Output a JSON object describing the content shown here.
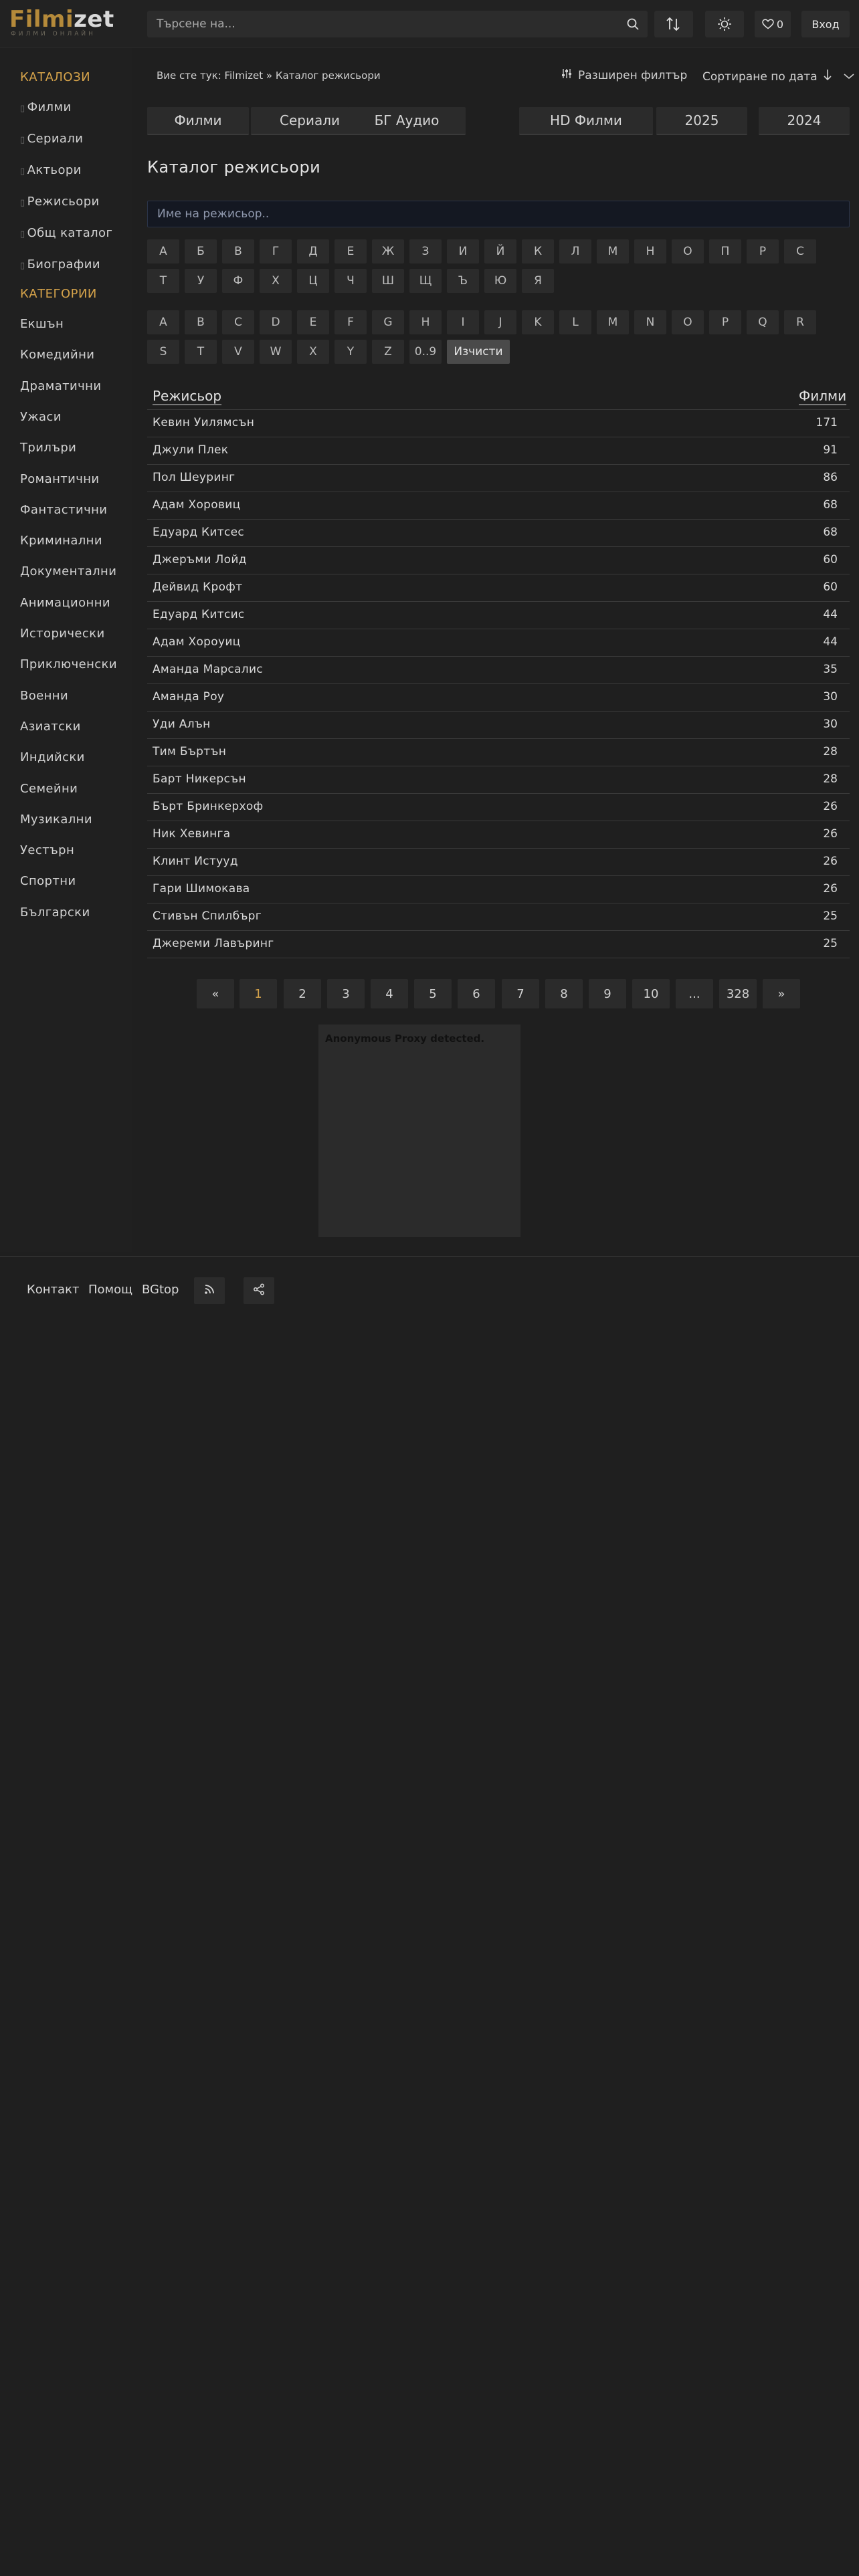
{
  "header": {
    "logo_part1": "Filmi",
    "logo_part2": "zet",
    "logo_tagline": "ФИЛМИ ОНЛАЙН",
    "search_placeholder": "Търсене на...",
    "favorites_count": "0",
    "login_label": "Вход"
  },
  "sidebar": {
    "catalogs_heading": "КАТАЛОЗИ",
    "catalogs": [
      "Филми",
      "Сериали",
      "Актьори",
      "Режисьори",
      "Общ каталог",
      "Биографии"
    ],
    "categories_heading": "КАТЕГОРИИ",
    "categories": [
      "Екшън",
      "Комедийни",
      "Драматични",
      "Ужаси",
      "Трилъри",
      "Романтични",
      "Фантастични",
      "Криминални",
      "Документални",
      "Анимационни",
      "Исторически",
      "Приключенски",
      "Военни",
      "Азиатски",
      "Индийски",
      "Семейни",
      "Музикални",
      "Уестърн",
      "Спортни",
      "Български"
    ]
  },
  "breadcrumb": "Вие сте тук: Filmizet » Каталог режисьори",
  "advanced_filter_label": "Разширен  филтър",
  "sort_label": "Сортиране по дата",
  "tabs": [
    "Филми",
    "Сериали",
    "БГ Аудио",
    "HD Филми",
    "2025",
    "2024"
  ],
  "page_title": "Каталог режисьори",
  "name_placeholder": "Име на режисьор..",
  "cyrillic_letters": [
    "А",
    "Б",
    "В",
    "Г",
    "Д",
    "Е",
    "Ж",
    "З",
    "И",
    "Й",
    "К",
    "Л",
    "М",
    "Н",
    "О",
    "П",
    "Р",
    "С",
    "Т",
    "У",
    "Ф",
    "Х",
    "Ц",
    "Ч",
    "Ш",
    "Щ",
    "Ъ",
    "Ю",
    "Я"
  ],
  "latin_letters": [
    "A",
    "B",
    "C",
    "D",
    "E",
    "F",
    "G",
    "H",
    "I",
    "J",
    "K",
    "L",
    "M",
    "N",
    "O",
    "P",
    "Q",
    "R",
    "S",
    "T",
    "V",
    "W",
    "X",
    "Y",
    "Z",
    "0..9"
  ],
  "clear_label": "Изчисти",
  "table": {
    "col_director": "Режисьор",
    "col_films": "Филми",
    "rows": [
      {
        "name": "Кевин Уилямсън",
        "count": "171"
      },
      {
        "name": "Джули Плек",
        "count": "91"
      },
      {
        "name": "Пол Шеуринг",
        "count": "86"
      },
      {
        "name": "Адам Хоровиц",
        "count": "68"
      },
      {
        "name": "Едуард Китсес",
        "count": "68"
      },
      {
        "name": "Джеръми Лойд",
        "count": "60"
      },
      {
        "name": "Дейвид Крофт",
        "count": "60"
      },
      {
        "name": "Едуард Китсис",
        "count": "44"
      },
      {
        "name": "Адам Хороуиц",
        "count": "44"
      },
      {
        "name": "Аманда Марсалис",
        "count": "35"
      },
      {
        "name": "Аманда Роу",
        "count": "30"
      },
      {
        "name": "Уди Алън",
        "count": "30"
      },
      {
        "name": "Тим Бъртън",
        "count": "28"
      },
      {
        "name": "Барт Никерсън",
        "count": "28"
      },
      {
        "name": "Бърт Бринкерхоф",
        "count": "26"
      },
      {
        "name": "Ник Хевинга",
        "count": "26"
      },
      {
        "name": "Клинт Истууд",
        "count": "26"
      },
      {
        "name": "Гари Шимокава",
        "count": "26"
      },
      {
        "name": "Стивън Спилбърг",
        "count": "25"
      },
      {
        "name": "Джереми Лавъринг",
        "count": "25"
      }
    ]
  },
  "pagination": [
    "«",
    "1",
    "2",
    "3",
    "4",
    "5",
    "6",
    "7",
    "8",
    "9",
    "10",
    "...",
    "328",
    "»"
  ],
  "pagination_current": "1",
  "ad_text": "Anonymous Proxy detected.",
  "footer": {
    "contact": "Контакт",
    "help": "Помощ",
    "bgtop": "BGtop"
  },
  "colors": {
    "accent": "#d4a24a",
    "background": "#1f1f1f",
    "panel": "#2b2b2b"
  }
}
